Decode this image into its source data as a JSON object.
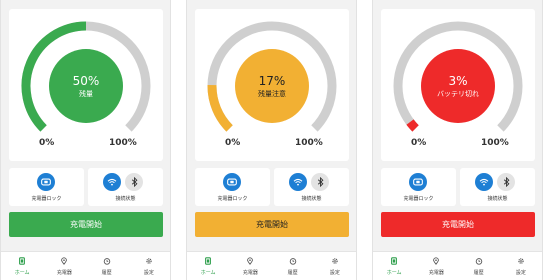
{
  "screens": [
    {
      "percent_value": 50,
      "percent_text": "50%",
      "status": "残量",
      "color": "#3aaa4f",
      "label_min": "0%",
      "label_max": "100%",
      "lock_label": "充電器ロック",
      "connection_label": "接続状態",
      "button_label": "充電開始",
      "nav": [
        "ホーム",
        "充電器",
        "履歴",
        "設定"
      ]
    },
    {
      "percent_value": 17,
      "percent_text": "17%",
      "status": "残量注意",
      "color": "#f2b033",
      "label_min": "0%",
      "label_max": "100%",
      "lock_label": "充電器ロック",
      "connection_label": "接続状態",
      "button_label": "充電開始",
      "nav": [
        "ホーム",
        "充電器",
        "履歴",
        "設定"
      ]
    },
    {
      "percent_value": 3,
      "percent_text": "3%",
      "status": "バッテリ切れ",
      "color": "#ee2a2a",
      "label_min": "0%",
      "label_max": "100%",
      "lock_label": "充電器ロック",
      "connection_label": "接続状態",
      "button_label": "充電開始",
      "nav": [
        "ホーム",
        "充電器",
        "履歴",
        "設定"
      ]
    }
  ],
  "track_color": "#cfcfcf",
  "icons": {
    "lock": "lock-icon",
    "wifi": "wifi-icon",
    "bluetooth": "bluetooth-icon",
    "nav": [
      "home-icon",
      "location-pin-icon",
      "clock-icon",
      "gear-icon"
    ]
  }
}
